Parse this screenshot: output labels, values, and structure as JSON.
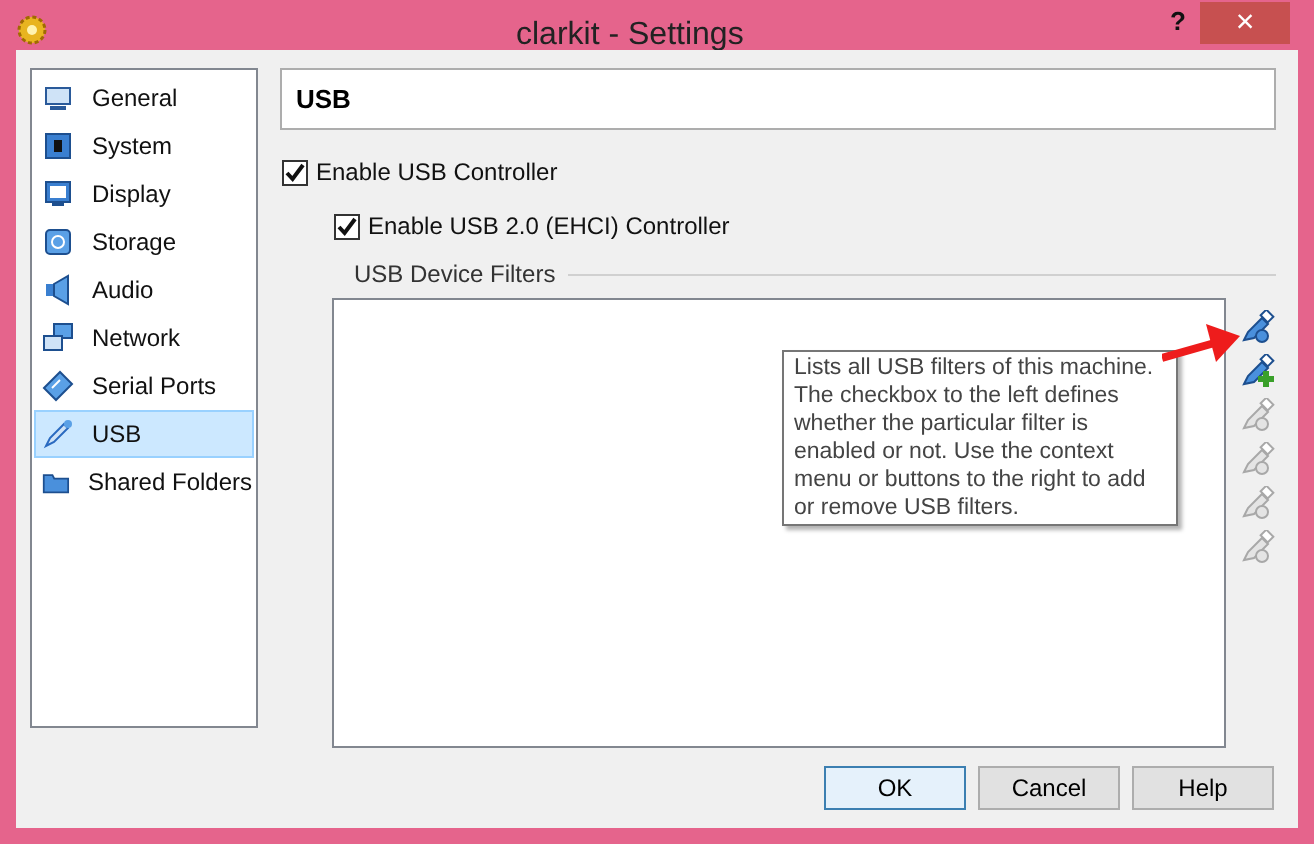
{
  "window": {
    "title": "clarkit - Settings",
    "help": "?",
    "close": "×"
  },
  "sidebar": {
    "items": [
      {
        "label": "General",
        "selected": false
      },
      {
        "label": "System",
        "selected": false
      },
      {
        "label": "Display",
        "selected": false
      },
      {
        "label": "Storage",
        "selected": false
      },
      {
        "label": "Audio",
        "selected": false
      },
      {
        "label": "Network",
        "selected": false
      },
      {
        "label": "Serial Ports",
        "selected": false
      },
      {
        "label": "USB",
        "selected": true
      },
      {
        "label": "Shared Folders",
        "selected": false
      }
    ]
  },
  "page_title": "USB",
  "options": [
    {
      "label": "Enable USB Controller",
      "checked": true
    },
    {
      "label": "Enable USB 2.0 (EHCI) Controller",
      "checked": true
    }
  ],
  "filters": {
    "title": "USB Device Filters",
    "tools": [
      {
        "disabled": false
      },
      {
        "disabled": false
      },
      {
        "disabled": true
      },
      {
        "disabled": true
      },
      {
        "disabled": true
      },
      {
        "disabled": true
      }
    ],
    "tooltip": "Lists all USB filters of this machine. The checkbox to the left defines whether the particular filter is enabled or not. Use the context menu or buttons to the right to add or remove USB filters."
  },
  "buttons": [
    {
      "label": "OK",
      "default": true
    },
    {
      "label": "Cancel",
      "default": false
    },
    {
      "label": "Help",
      "default": false
    }
  ]
}
